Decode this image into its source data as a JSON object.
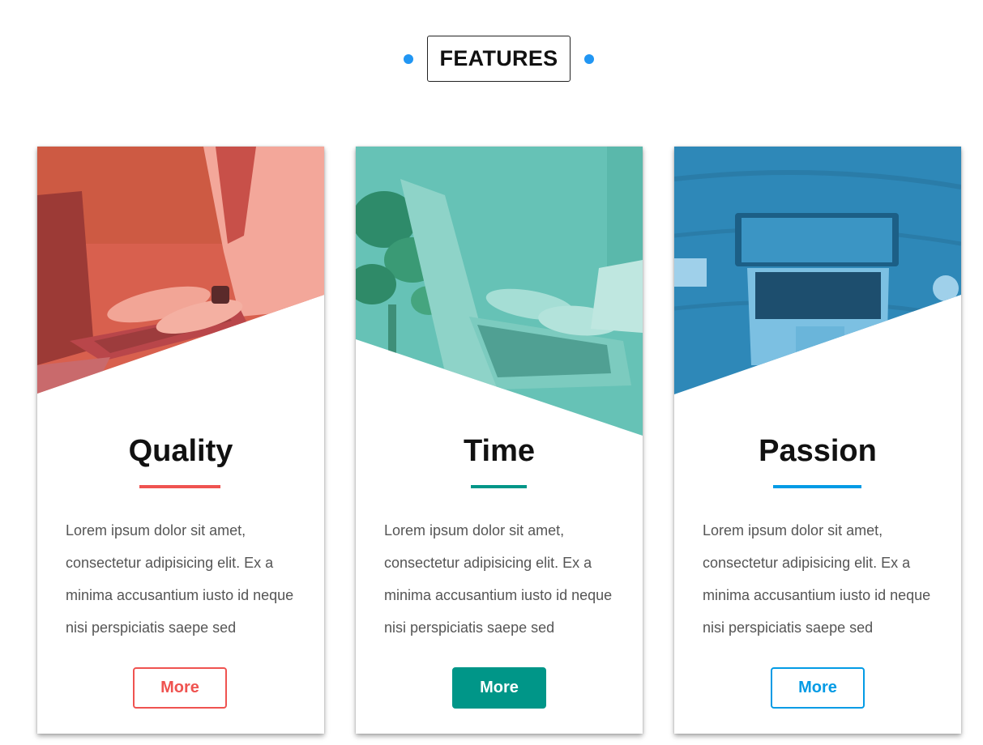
{
  "header": {
    "title": "FEATURES"
  },
  "colors": {
    "accent_dot": "#2196f3",
    "quality": "#ef5350",
    "time": "#009688",
    "passion": "#039be5"
  },
  "cards": [
    {
      "title": "Quality",
      "text": "Lorem ipsum dolor sit amet, consectetur adipisicing elit. Ex a minima accusantium iusto id neque nisi perspiciatis saepe sed",
      "button": "More",
      "image_desc_icon": "laptop-typing-image",
      "color": "#ef5350"
    },
    {
      "title": "Time",
      "text": "Lorem ipsum dolor sit amet, consectetur adipisicing elit. Ex a minima accusantium iusto id neque nisi perspiciatis saepe sed",
      "button": "More",
      "image_desc_icon": "laptop-typing-image",
      "color": "#009688"
    },
    {
      "title": "Passion",
      "text": "Lorem ipsum dolor sit amet, consectetur adipisicing elit. Ex a minima accusantium iusto id neque nisi perspiciatis saepe sed",
      "button": "More",
      "image_desc_icon": "laptop-desk-image",
      "color": "#039be5"
    }
  ]
}
